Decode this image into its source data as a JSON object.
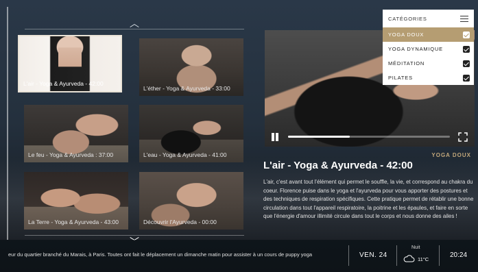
{
  "grid": {
    "items": [
      {
        "caption": "L'air - Yoga & Ayurveda - 42:00",
        "active": true
      },
      {
        "caption": "L'éther - Yoga & Ayurveda - 33:00",
        "active": false
      },
      {
        "caption": "Le feu - Yoga & Ayurveda : 37:00",
        "active": false
      },
      {
        "caption": "L'eau - Yoga & Ayurveda - 41:00",
        "active": false
      },
      {
        "caption": "La Terre - Yoga & Ayurveda - 43:00",
        "active": false
      },
      {
        "caption": "Découvrir l'Ayurveda - 00:00",
        "active": false
      }
    ]
  },
  "player": {
    "progress": 0.38,
    "play_icon": "pause-icon",
    "fullscreen_icon": "fullscreen-icon"
  },
  "detail": {
    "category_tag": "YOGA DOUX",
    "title": "L'air - Yoga & Ayurveda - 42:00",
    "description": "L'air, c'est avant tout l'élément qui permet le souffle, la vie, et correspond au chakra du coeur. Florence puise dans le yoga et l'ayurveda pour vous apporter des postures et des techniques de respiration spécifiques. Cette pratique permet de rétablir une bonne circulation dans tout l'appareil respiratoire, la poitrine et les épaules, et faire en sorte que l'énergie d'amour illimité circule dans tout le corps et nous donne des ailes !"
  },
  "categories": {
    "title": "CATÉGORIES",
    "items": [
      {
        "label": "YOGA DOUX",
        "checked": true,
        "selected": true
      },
      {
        "label": "YOGA DYNAMIQUE",
        "checked": true,
        "selected": false
      },
      {
        "label": "MÉDITATION",
        "checked": true,
        "selected": false
      },
      {
        "label": "PILATES",
        "checked": true,
        "selected": false
      }
    ]
  },
  "footer": {
    "ticker": "eur du quartier branché du Marais, à Paris. Toutes ont fait le déplacement un dimanche matin pour assister à un cours de puppy yoga",
    "date": "VEN. 24",
    "weather_label": "Nuit",
    "temperature": "11°C",
    "time": "20:24"
  },
  "colors": {
    "accent": "#b59d72",
    "tag": "#c2a77b"
  }
}
